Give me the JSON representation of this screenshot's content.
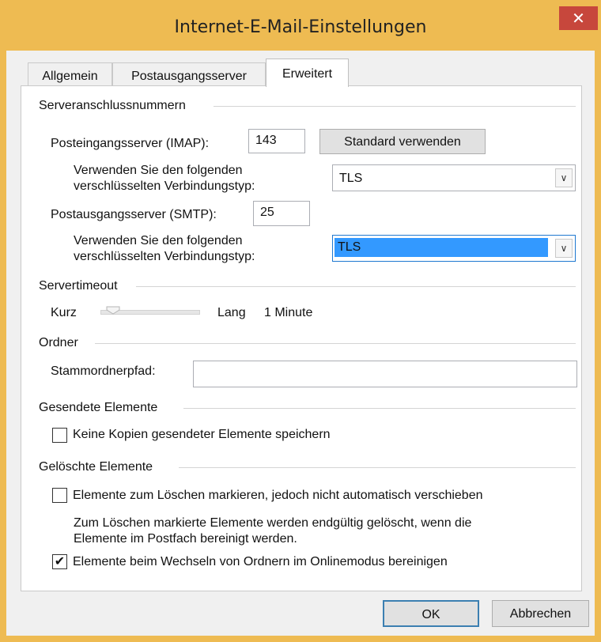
{
  "window": {
    "title": "Internet-E-Mail-Einstellungen",
    "close_glyph": "✕"
  },
  "tabs": [
    {
      "label": "Allgemein"
    },
    {
      "label": "Postausgangsserver"
    },
    {
      "label": "Erweitert"
    }
  ],
  "ports": {
    "section": "Serveranschlussnummern",
    "incoming_label": "Posteingangsserver (IMAP):",
    "incoming_value": "143",
    "default_button": "Standard verwenden",
    "enc1_label_line1": "Verwenden Sie den folgenden",
    "enc1_label_line2": "verschlüsselten Verbindungstyp:",
    "enc1_value": "TLS",
    "outgoing_label": "Postausgangsserver (SMTP):",
    "outgoing_value": "25",
    "enc2_label_line1": "Verwenden Sie den folgenden",
    "enc2_label_line2": "verschlüsselten Verbindungstyp:",
    "enc2_value": "TLS"
  },
  "timeout": {
    "section": "Servertimeout",
    "short_label": "Kurz",
    "long_label": "Lang",
    "value_text": "1 Minute",
    "slider_level": 0.05
  },
  "folders": {
    "section": "Ordner",
    "root_label": "Stammordnerpfad:",
    "root_value": ""
  },
  "sent": {
    "section": "Gesendete Elemente",
    "no_copies_label": "Keine Kopien gesendeter Elemente speichern",
    "no_copies_checked": false
  },
  "deleted": {
    "section": "Gelöschte Elemente",
    "mark_label": "Elemente zum Löschen markieren, jedoch nicht automatisch verschieben",
    "mark_checked": false,
    "info_line1": "Zum Löschen markierte Elemente werden endgültig gelöscht, wenn die",
    "info_line2": "Elemente im Postfach bereinigt werden.",
    "purge_label": "Elemente beim Wechseln von Ordnern im Onlinemodus bereinigen",
    "purge_checked": true,
    "check_glyph": "✔"
  },
  "buttons": {
    "ok": "OK",
    "cancel": "Abbrechen"
  }
}
